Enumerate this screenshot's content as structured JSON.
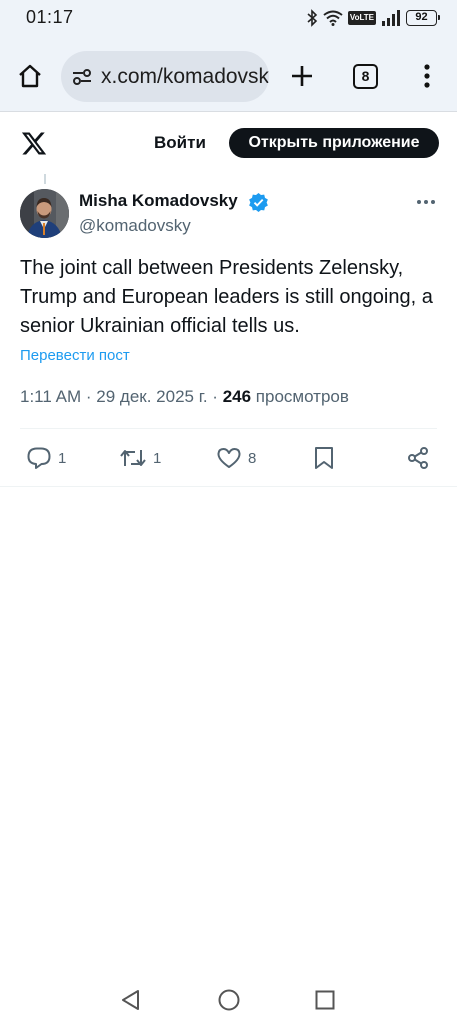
{
  "status_bar": {
    "time": "01:17",
    "volte_label": "VoLTE",
    "battery": "92",
    "icons": [
      "bluetooth-icon",
      "wifi-icon",
      "volte-icon",
      "signal-icon",
      "battery-icon"
    ]
  },
  "browser": {
    "url": "x.com/komadovsky",
    "tab_count": "8",
    "icons": [
      "home-icon",
      "site-settings-icon",
      "new-tab-icon",
      "tabs-icon",
      "menu-icon"
    ]
  },
  "header": {
    "login_label": "Войти",
    "open_app_label": "Открыть приложение"
  },
  "tweet": {
    "author_name": "Misha Komadovsky",
    "handle": "@komadovsky",
    "verified": true,
    "text": "The joint call between Presidents Zelensky, Trump and European leaders is still ongoing, a senior Ukrainian official tells us.",
    "translate_label": "Перевести пост",
    "time": "1:11 AM",
    "date": "29 дек. 2025 г.",
    "separator": "·",
    "views_count": "246",
    "views_label": "просмотров",
    "reply_count": "1",
    "retweet_count": "1",
    "like_count": "8"
  },
  "colors": {
    "accent": "#1d9bf0",
    "text": "#0f1419",
    "secondary": "#536471",
    "chrome_bg": "#eef3f9"
  }
}
